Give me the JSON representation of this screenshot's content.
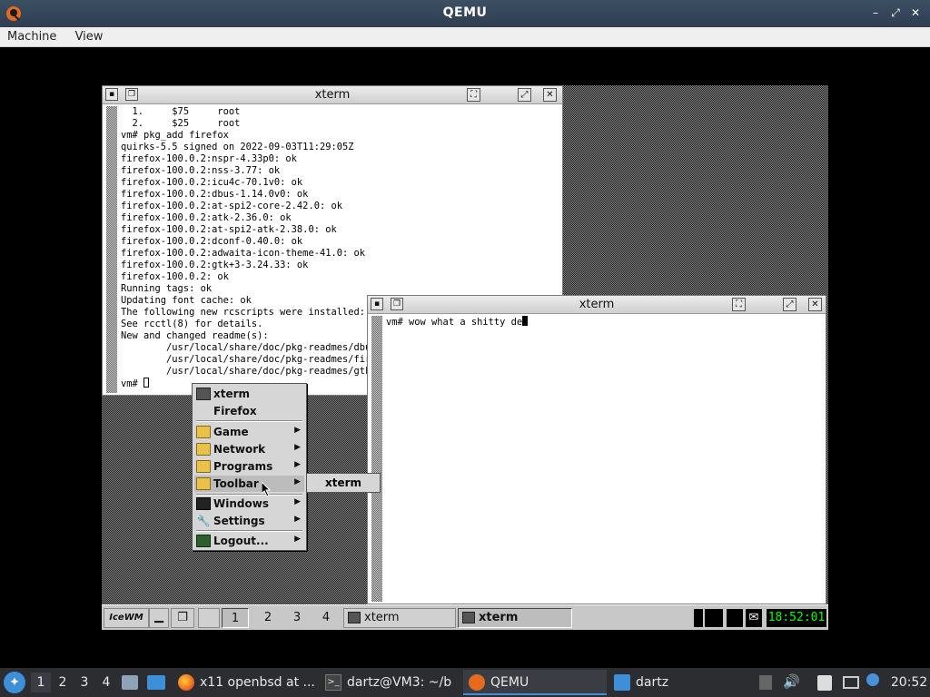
{
  "host_window": {
    "title": "QEMU",
    "menu": [
      "Machine",
      "View"
    ],
    "controls": {
      "minimize": "–",
      "restore": "⤢",
      "close": "✕"
    }
  },
  "guest": {
    "xterm1": {
      "title": "xterm",
      "lines": [
        "  1.     $75     root",
        "  2.     $25     root",
        "vm# pkg_add firefox",
        "quirks-5.5 signed on 2022-09-03T11:29:05Z",
        "firefox-100.0.2:nspr-4.33p0: ok",
        "firefox-100.0.2:nss-3.77: ok",
        "firefox-100.0.2:icu4c-70.1v0: ok",
        "firefox-100.0.2:dbus-1.14.0v0: ok",
        "firefox-100.0.2:at-spi2-core-2.42.0: ok",
        "firefox-100.0.2:atk-2.36.0: ok",
        "firefox-100.0.2:at-spi2-atk-2.38.0: ok",
        "firefox-100.0.2:dconf-0.40.0: ok",
        "firefox-100.0.2:adwaita-icon-theme-41.0: ok",
        "firefox-100.0.2:gtk+3-3.24.33: ok",
        "firefox-100.0.2: ok",
        "Running tags: ok",
        "Updating font cache: ok",
        "The following new rcscripts were installed: /",
        "See rcctl(8) for details.",
        "New and changed readme(s):",
        "        /usr/local/share/doc/pkg-readmes/dbus",
        "        /usr/local/share/doc/pkg-readmes/fire",
        "        /usr/local/share/doc/pkg-readmes/gtk+",
        "vm# "
      ]
    },
    "xterm2": {
      "title": "xterm",
      "command_line": "vm# wow what a shitty de"
    },
    "start_menu": {
      "items": [
        {
          "label": "xterm",
          "icon": "terminal-icon",
          "submenu": false
        },
        {
          "label": "Firefox",
          "icon": "",
          "submenu": false
        },
        {
          "label": "Game",
          "icon": "folder-icon",
          "submenu": true
        },
        {
          "label": "Network",
          "icon": "folder-icon",
          "submenu": true
        },
        {
          "label": "Programs",
          "icon": "folder-icon",
          "submenu": true
        },
        {
          "label": "Toolbar",
          "icon": "folder-icon",
          "submenu": true
        },
        {
          "label": "Windows",
          "icon": "windows-icon",
          "submenu": true
        },
        {
          "label": "Settings",
          "icon": "wrench-icon",
          "submenu": true
        },
        {
          "label": "Logout...",
          "icon": "logout-icon",
          "submenu": true
        }
      ],
      "submenu_item": "xterm"
    },
    "taskbar": {
      "start_label": "IceWM",
      "workspaces": [
        "1",
        "2",
        "3",
        "4"
      ],
      "tasks": [
        {
          "label": "xterm",
          "active": false
        },
        {
          "label": "xterm",
          "active": true
        }
      ],
      "clock": "18:52:01"
    }
  },
  "host_panel": {
    "workspaces": [
      "1",
      "2",
      "3",
      "4"
    ],
    "tasks": [
      {
        "label": "x11 openbsd at ...",
        "icon": "firefox-icon"
      },
      {
        "label": "dartz@VM3: ~/b",
        "icon": "terminal-icon"
      },
      {
        "label": "QEMU",
        "icon": "qemu-icon"
      },
      {
        "label": "dartz",
        "icon": "folder-icon"
      }
    ],
    "clock": "20:52"
  }
}
